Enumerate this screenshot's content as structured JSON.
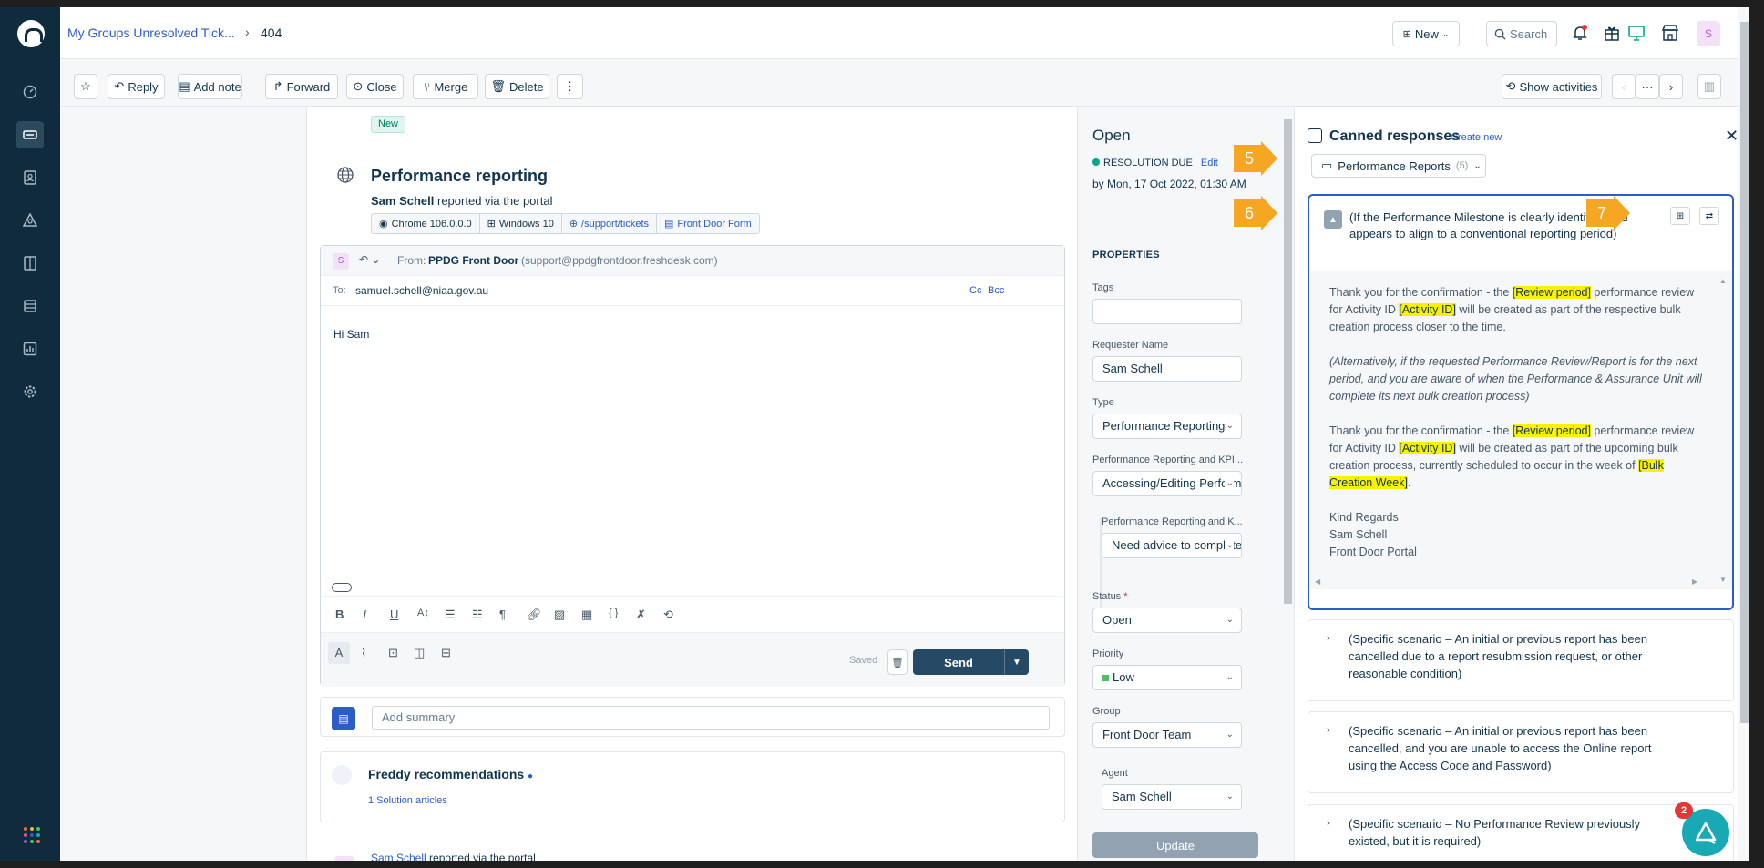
{
  "header": {
    "breadcrumb_link": "My Groups Unresolved Tick...",
    "breadcrumb_sep": "›",
    "ticket_id": "404",
    "new_label": "New",
    "search_placeholder": "Search",
    "avatar_initial": "S"
  },
  "toolbar": {
    "reply": "Reply",
    "add_note": "Add note",
    "forward": "Forward",
    "close": "Close",
    "merge": "Merge",
    "delete": "Delete",
    "more": "⋮",
    "show_activities": "Show activities"
  },
  "ticket": {
    "badge": "New",
    "title": "Performance reporting",
    "requester": "Sam Schell",
    "reported_via": "reported via the portal",
    "chips": [
      "Chrome 106.0.0.0",
      "Windows 10",
      "/support/tickets",
      "Front Door Form"
    ]
  },
  "compose": {
    "avatar": "S",
    "from_label": "From:",
    "from_name": "PPDG Front Door",
    "from_email": "(support@ppdgfrontdoor.freshdesk.com)",
    "to_label": "To:",
    "to_email": "samuel.schell@niaa.gov.au",
    "cc": "Cc",
    "bcc": "Bcc",
    "body": "Hi Sam",
    "saved": "Saved",
    "send": "Send"
  },
  "summary": {
    "placeholder": "Add summary"
  },
  "freddy": {
    "title": "Freddy recommendations",
    "link": "1 Solution articles"
  },
  "next_entry": {
    "requester": "Sam Schell",
    "reported_via": "reported via the portal"
  },
  "properties": {
    "status_title": "Open",
    "resolution_due": "RESOLUTION DUE",
    "edit": "Edit",
    "due_date": "by Mon, 17 Oct 2022, 01:30 AM",
    "heading": "PROPERTIES",
    "tags_label": "Tags",
    "requester_label": "Requester Name",
    "requester_value": "Sam Schell",
    "type_label": "Type",
    "type_value": "Performance Reporting",
    "perf_label": "Performance Reporting and KPI...",
    "perf_value": "Accessing/Editing Performance",
    "perf2_label": "Performance Reporting and K...",
    "perf2_value": "Need advice to complete",
    "status_label": "Status",
    "required_mark": "*",
    "status_value": "Open",
    "priority_label": "Priority",
    "priority_value": "Low",
    "group_label": "Group",
    "group_value": "Front Door Team",
    "agent_label": "Agent",
    "agent_value": "Sam Schell",
    "update": "Update"
  },
  "canned": {
    "title": "Canned responses",
    "create_new": "Create new",
    "folder": "Performance Reports",
    "folder_count": "(5)",
    "expanded_title": "(If the Performance Milestone is clearly identified and appears to align to a conventional reporting period)",
    "p1_a": "Thank you for the confirmation - the ",
    "p1_hl1": "[Review period]",
    "p1_b": " performance review for Activity ID ",
    "p1_hl2": "[Activity ID]",
    "p1_c": " will be created as part of the respective bulk creation process closer to the time.",
    "p2": "(Alternatively, if the requested Performance Review/Report is for the next period, and you are aware of when the Performance & Assurance Unit will complete its next bulk creation process)",
    "p3_a": "Thank you for the confirmation - the ",
    "p3_hl1": "[Review period]",
    "p3_b": " performance review for Activity ID ",
    "p3_hl2": "[Activity ID]",
    "p3_c": " will be created as part of the upcoming bulk creation process, currently scheduled to occur in the week of ",
    "p3_hl3": "[Bulk Creation Week]",
    "p3_d": ".",
    "sign1": "Kind Regards",
    "sign2": "Sam Schell",
    "sign3": "Front Door Portal",
    "items": [
      "(Specific scenario – An initial or previous report has been cancelled due to a report resubmission request, or other reasonable condition)",
      "(Specific scenario – An initial or previous report has been cancelled, and you are unable to access the Online report using the Access Code and Password)",
      "(Specific scenario – No Performance Review previously existed, but it is required)"
    ]
  },
  "markers": [
    "5",
    "6",
    "7"
  ],
  "bot_badge": "2",
  "colors": {
    "sidebar": "#0f2b3d",
    "link": "#2c5cc5",
    "highlight": "#f8f200",
    "marker": "#f5a623",
    "send": "#264966"
  }
}
